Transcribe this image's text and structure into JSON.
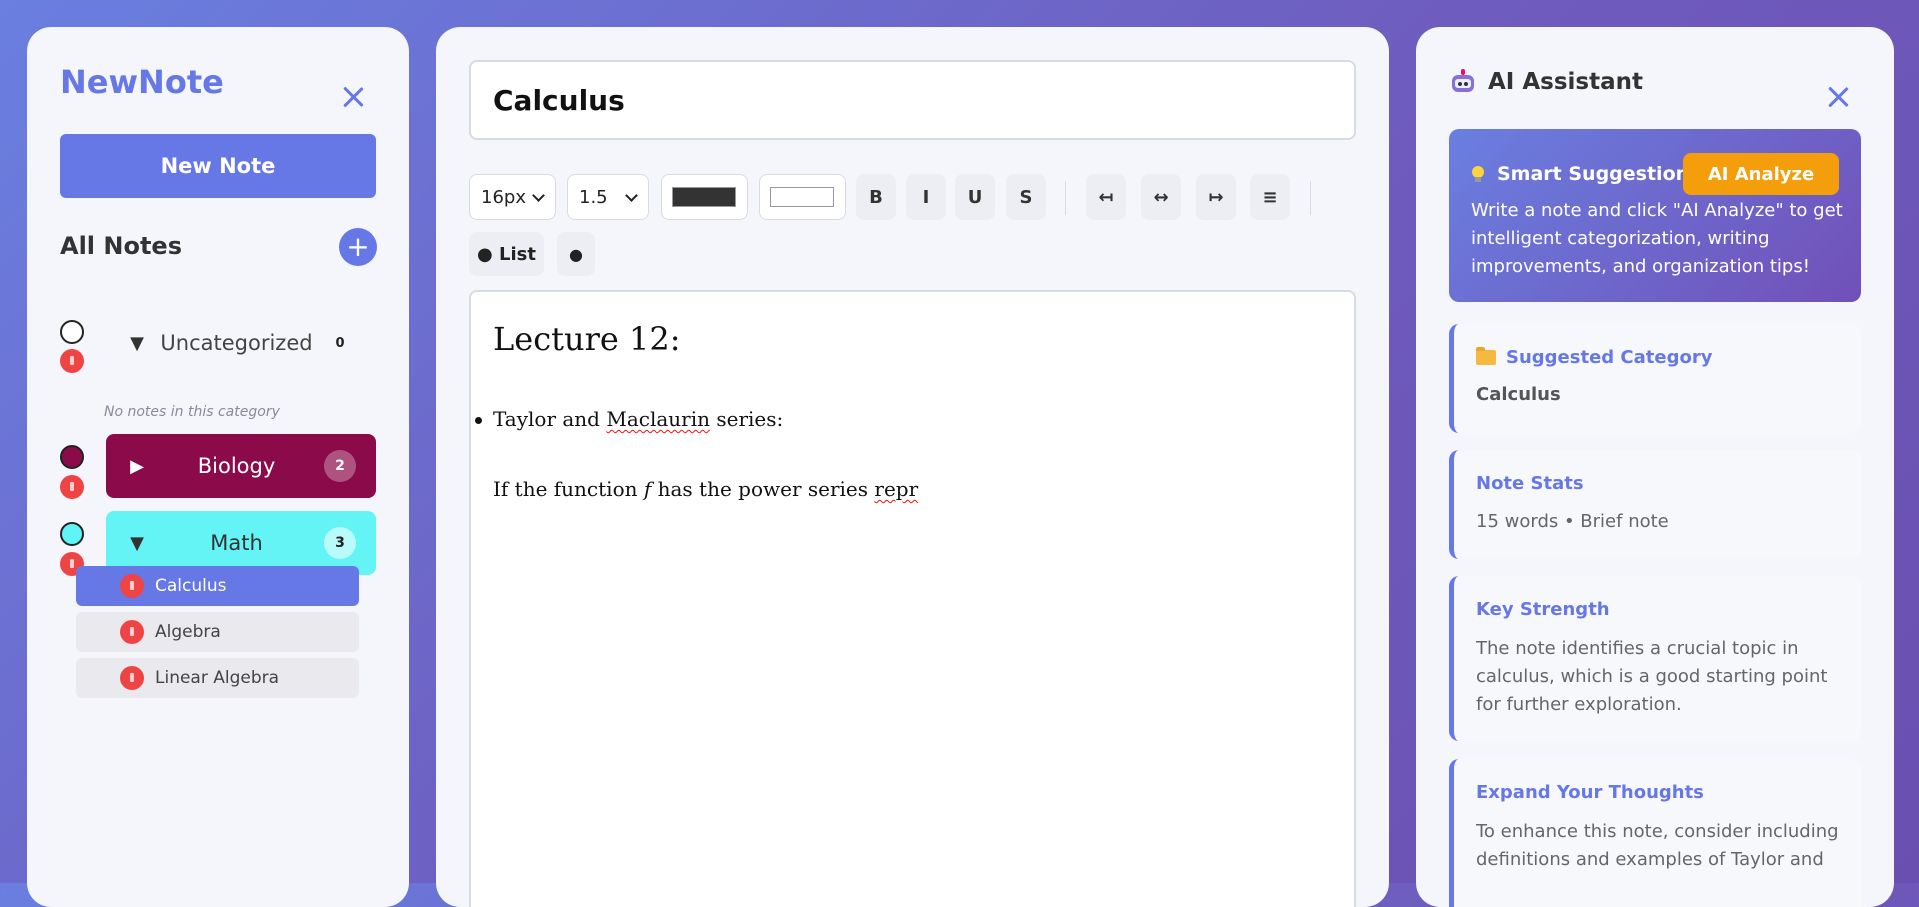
{
  "sidebar": {
    "brand": "NewNote",
    "new_note_label": "New Note",
    "all_notes_label": "All Notes",
    "add_category_label": "+",
    "categories": [
      {
        "name": "Uncategorized",
        "count": "0",
        "arrow": "▼",
        "color": "#ffffff",
        "expanded": true,
        "empty_text": "No notes in this category"
      },
      {
        "name": "Biology",
        "count": "2",
        "arrow": "▶",
        "color": "#8b0a4a",
        "expanded": false
      },
      {
        "name": "Math",
        "count": "3",
        "arrow": "▼",
        "color": "#5ff5f5",
        "expanded": true
      }
    ],
    "math_notes": [
      {
        "title": "Calculus",
        "active": true
      },
      {
        "title": "Algebra",
        "active": false
      },
      {
        "title": "Linear Algebra",
        "active": false
      }
    ]
  },
  "editor": {
    "title_value": "Calculus",
    "toolbar": {
      "font_size": "16px",
      "line_height": "1.5",
      "text_color": "#333333",
      "highlight_color": "#ffffff",
      "bold": "B",
      "italic": "I",
      "underline": "U",
      "strike": "S",
      "align_left": "↤",
      "align_center": "↔",
      "align_right": "↦",
      "justify": "≡",
      "bullet_list": "● List",
      "dot": "●"
    },
    "content": {
      "heading": "Lecture 12:",
      "bullet_prefix": "Taylor and ",
      "bullet_flagged": "Maclaurin",
      "bullet_suffix": " series:",
      "para_prefix": "If the function ",
      "para_var": "f",
      "para_middle": " has the power series ",
      "para_flagged": "repr"
    }
  },
  "assistant": {
    "title": "AI Assistant",
    "suggestions": {
      "heading": "Smart Suggestions",
      "button": "AI Analyze",
      "text": "Write a note and click \"AI Analyze\" to get intelligent categorization, writing improvements, and organization tips!"
    },
    "cards": [
      {
        "title": "Suggested Category",
        "body": "Calculus"
      },
      {
        "title": "Note Stats",
        "body": "15 words • Brief note"
      },
      {
        "title": "Key Strength",
        "body": "The note identifies a crucial topic in calculus, which is a good starting point for further exploration."
      },
      {
        "title": "Expand Your Thoughts",
        "body": "To enhance this note, consider including definitions and examples of Taylor and"
      }
    ]
  },
  "colors": {
    "accent": "#6677e6",
    "delete": "#ef4444",
    "analyze": "#f59e0b"
  }
}
